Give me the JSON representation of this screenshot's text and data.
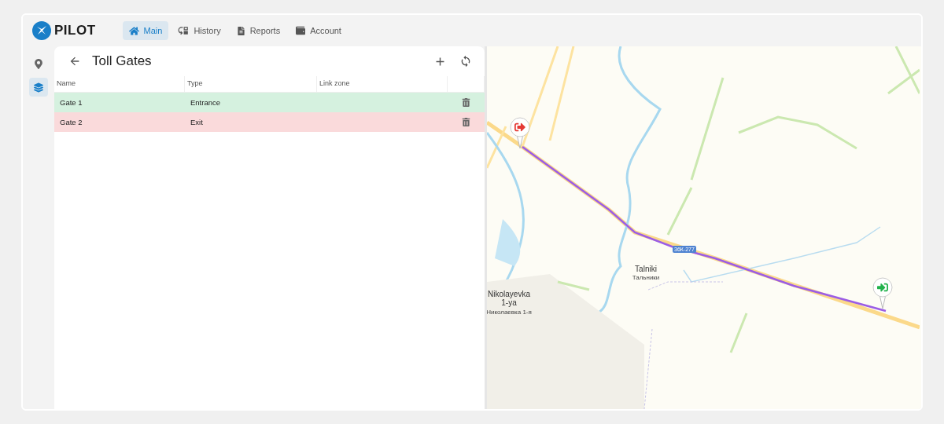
{
  "brand": "PILOT",
  "nav": [
    {
      "label": "Main",
      "selected": true
    },
    {
      "label": "History",
      "selected": false
    },
    {
      "label": "Reports",
      "selected": false
    },
    {
      "label": "Account",
      "selected": false
    }
  ],
  "sidebar": [
    {
      "selected": false
    },
    {
      "selected": true
    }
  ],
  "panel": {
    "title": "Toll Gates"
  },
  "table": {
    "columns": [
      "Name",
      "Type",
      "Link zone"
    ],
    "rows": [
      {
        "name": "Gate 1",
        "type": "Entrance",
        "kind": "entrance"
      },
      {
        "name": "Gate 2",
        "type": "Exit",
        "kind": "exit"
      }
    ]
  },
  "map": {
    "road_shield": "36К-277",
    "places": [
      {
        "name": "Talniki",
        "local": "Тальники"
      },
      {
        "name": "Nikolayevka 1-ya",
        "local": "Николаевка 1-я"
      }
    ],
    "markers": [
      {
        "kind": "exit"
      },
      {
        "kind": "entrance"
      }
    ]
  }
}
